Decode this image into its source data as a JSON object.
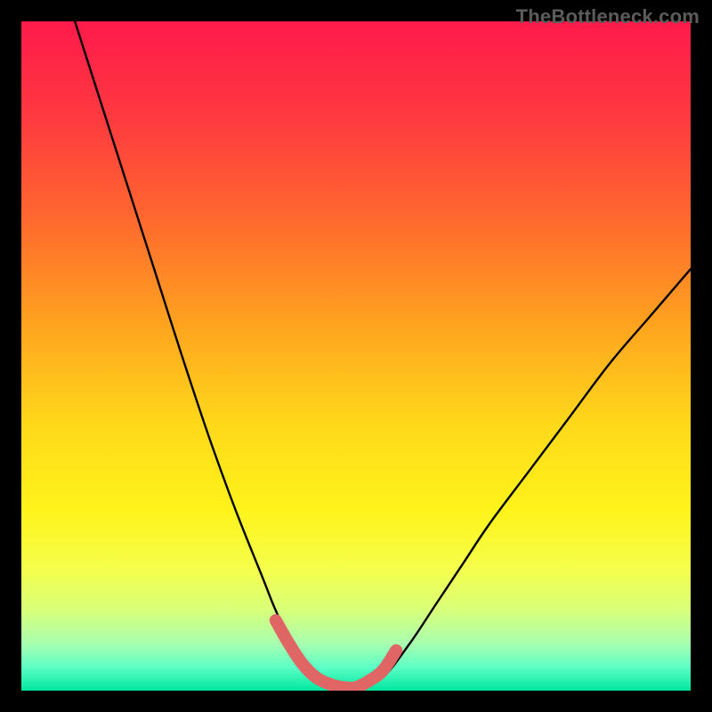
{
  "watermark": "TheBottleneck.com",
  "chart_data": {
    "type": "line",
    "title": "",
    "xlabel": "",
    "ylabel": "",
    "xlim": [
      0,
      100
    ],
    "ylim": [
      0,
      100
    ],
    "series": [
      {
        "name": "bottleneck-curve",
        "x": [
          8,
          12,
          16,
          20,
          24,
          28,
          32,
          36,
          38,
          40,
          44,
          48,
          50,
          54,
          58,
          62,
          66,
          70,
          76,
          82,
          88,
          94,
          100
        ],
        "y": [
          100,
          87.5,
          75,
          62.5,
          50,
          38,
          27,
          17,
          12,
          8,
          2,
          0,
          0,
          2,
          7,
          13,
          19,
          25,
          33,
          41,
          49,
          56,
          63
        ]
      },
      {
        "name": "valley-highlight",
        "x": [
          38,
          40,
          42,
          44,
          46,
          48,
          50,
          52,
          54,
          56
        ],
        "y": [
          10.5,
          7,
          4,
          2,
          1,
          0.5,
          0.5,
          1.5,
          3,
          6
        ]
      }
    ],
    "background": {
      "type": "vertical-gradient",
      "stops": [
        {
          "offset": 0.0,
          "color": "#ff1a4b"
        },
        {
          "offset": 0.15,
          "color": "#ff3b3f"
        },
        {
          "offset": 0.3,
          "color": "#ff6a2e"
        },
        {
          "offset": 0.45,
          "color": "#ffa21f"
        },
        {
          "offset": 0.6,
          "color": "#ffd81a"
        },
        {
          "offset": 0.73,
          "color": "#fff31a"
        },
        {
          "offset": 0.82,
          "color": "#f4ff4d"
        },
        {
          "offset": 0.88,
          "color": "#d8ff7a"
        },
        {
          "offset": 0.93,
          "color": "#a8ffb0"
        },
        {
          "offset": 0.965,
          "color": "#5cffc6"
        },
        {
          "offset": 1.0,
          "color": "#00e69e"
        }
      ]
    },
    "colors": {
      "curve": "#000000",
      "highlight": "#e06666"
    }
  }
}
